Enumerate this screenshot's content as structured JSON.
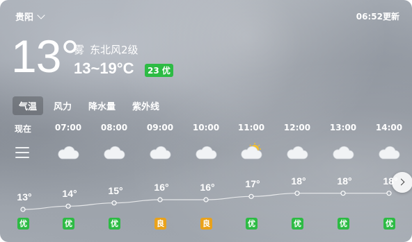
{
  "header": {
    "city": "贵阳",
    "update_time": "06:52更新"
  },
  "current": {
    "temperature": "13°",
    "condition": "雾",
    "wind": "东北风2级",
    "range": "13~19°C",
    "aqi": "23 优"
  },
  "colors": {
    "good": "#2dbb44",
    "moderate": "#e9a21b"
  },
  "tabs": [
    {
      "label": "气温",
      "active": true
    },
    {
      "label": "风力",
      "active": false
    },
    {
      "label": "降水量",
      "active": false
    },
    {
      "label": "紫外线",
      "active": false
    }
  ],
  "hourly": [
    {
      "time": "现在",
      "icon": "fog-icon",
      "temp": 13,
      "aqi": "优"
    },
    {
      "time": "07:00",
      "icon": "cloud-icon",
      "temp": 14,
      "aqi": "优"
    },
    {
      "time": "08:00",
      "icon": "cloud-icon",
      "temp": 15,
      "aqi": "优"
    },
    {
      "time": "09:00",
      "icon": "cloud-icon",
      "temp": 16,
      "aqi": "良"
    },
    {
      "time": "10:00",
      "icon": "cloud-icon",
      "temp": 16,
      "aqi": "良"
    },
    {
      "time": "11:00",
      "icon": "partly-sunny-icon",
      "temp": 17,
      "aqi": "优"
    },
    {
      "time": "12:00",
      "icon": "cloud-icon",
      "temp": 18,
      "aqi": "优"
    },
    {
      "time": "13:00",
      "icon": "cloud-icon",
      "temp": 18,
      "aqi": "优"
    },
    {
      "time": "14:00",
      "icon": "cloud-icon",
      "temp": 18,
      "aqi": "优"
    }
  ]
}
